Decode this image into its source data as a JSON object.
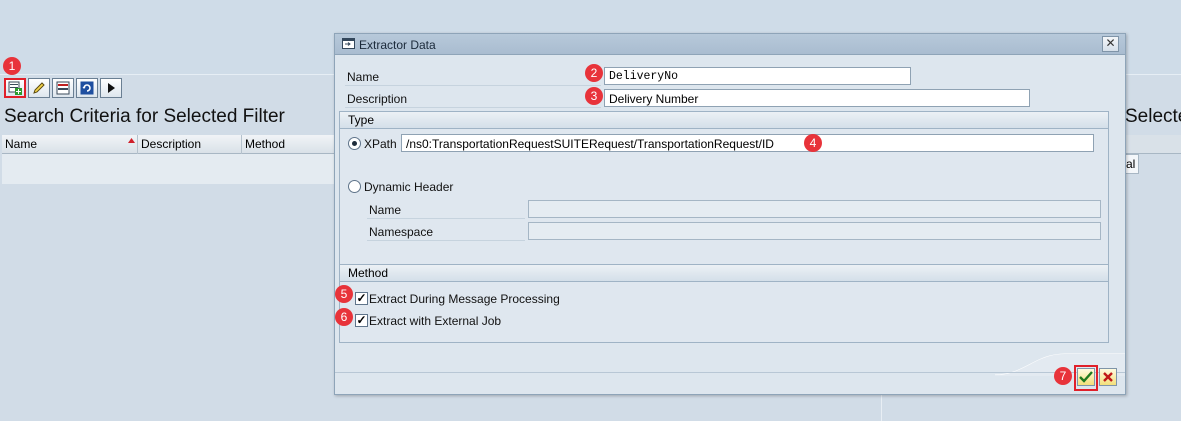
{
  "background": {
    "title": "Search Criteria for Selected Filter",
    "title_right": "Selecte...",
    "columns": [
      "Name",
      "Description",
      "Method"
    ],
    "right_cell_text": "al",
    "toolbar": [
      {
        "icon": "create-icon",
        "marker": "1"
      },
      {
        "icon": "edit-pencil-icon"
      },
      {
        "icon": "delete-icon"
      },
      {
        "icon": "refresh-icon"
      },
      {
        "icon": "execute-icon"
      }
    ]
  },
  "dialog": {
    "title": "Extractor Data",
    "close_glyph": "✕",
    "name_label": "Name",
    "name_value": "DeliveryNo",
    "name_marker": "2",
    "description_label": "Description",
    "description_value": "Delivery Number",
    "description_marker": "3",
    "type_group": {
      "title": "Type",
      "xpath_label": "XPath",
      "xpath_value": "/ns0:TransportationRequestSUITERequest/TransportationRequest/ID",
      "xpath_marker": "4",
      "xpath_selected": true,
      "dynamic_header_label": "Dynamic Header",
      "dh_name_label": "Name",
      "dh_name_value": "",
      "dh_namespace_label": "Namespace",
      "dh_namespace_value": ""
    },
    "method_group": {
      "title": "Method",
      "extract_during_label": "Extract During Message Processing",
      "extract_during_marker": "5",
      "extract_during_checked": true,
      "extract_external_label": "Extract with External Job",
      "extract_external_marker": "6",
      "extract_external_checked": true
    },
    "ok_marker": "7",
    "check_glyph": "✓"
  },
  "colors": {
    "marker_red": "#e8333a",
    "dialog_bg": "#dde6ee",
    "title_bar": "#b0c2d5"
  }
}
